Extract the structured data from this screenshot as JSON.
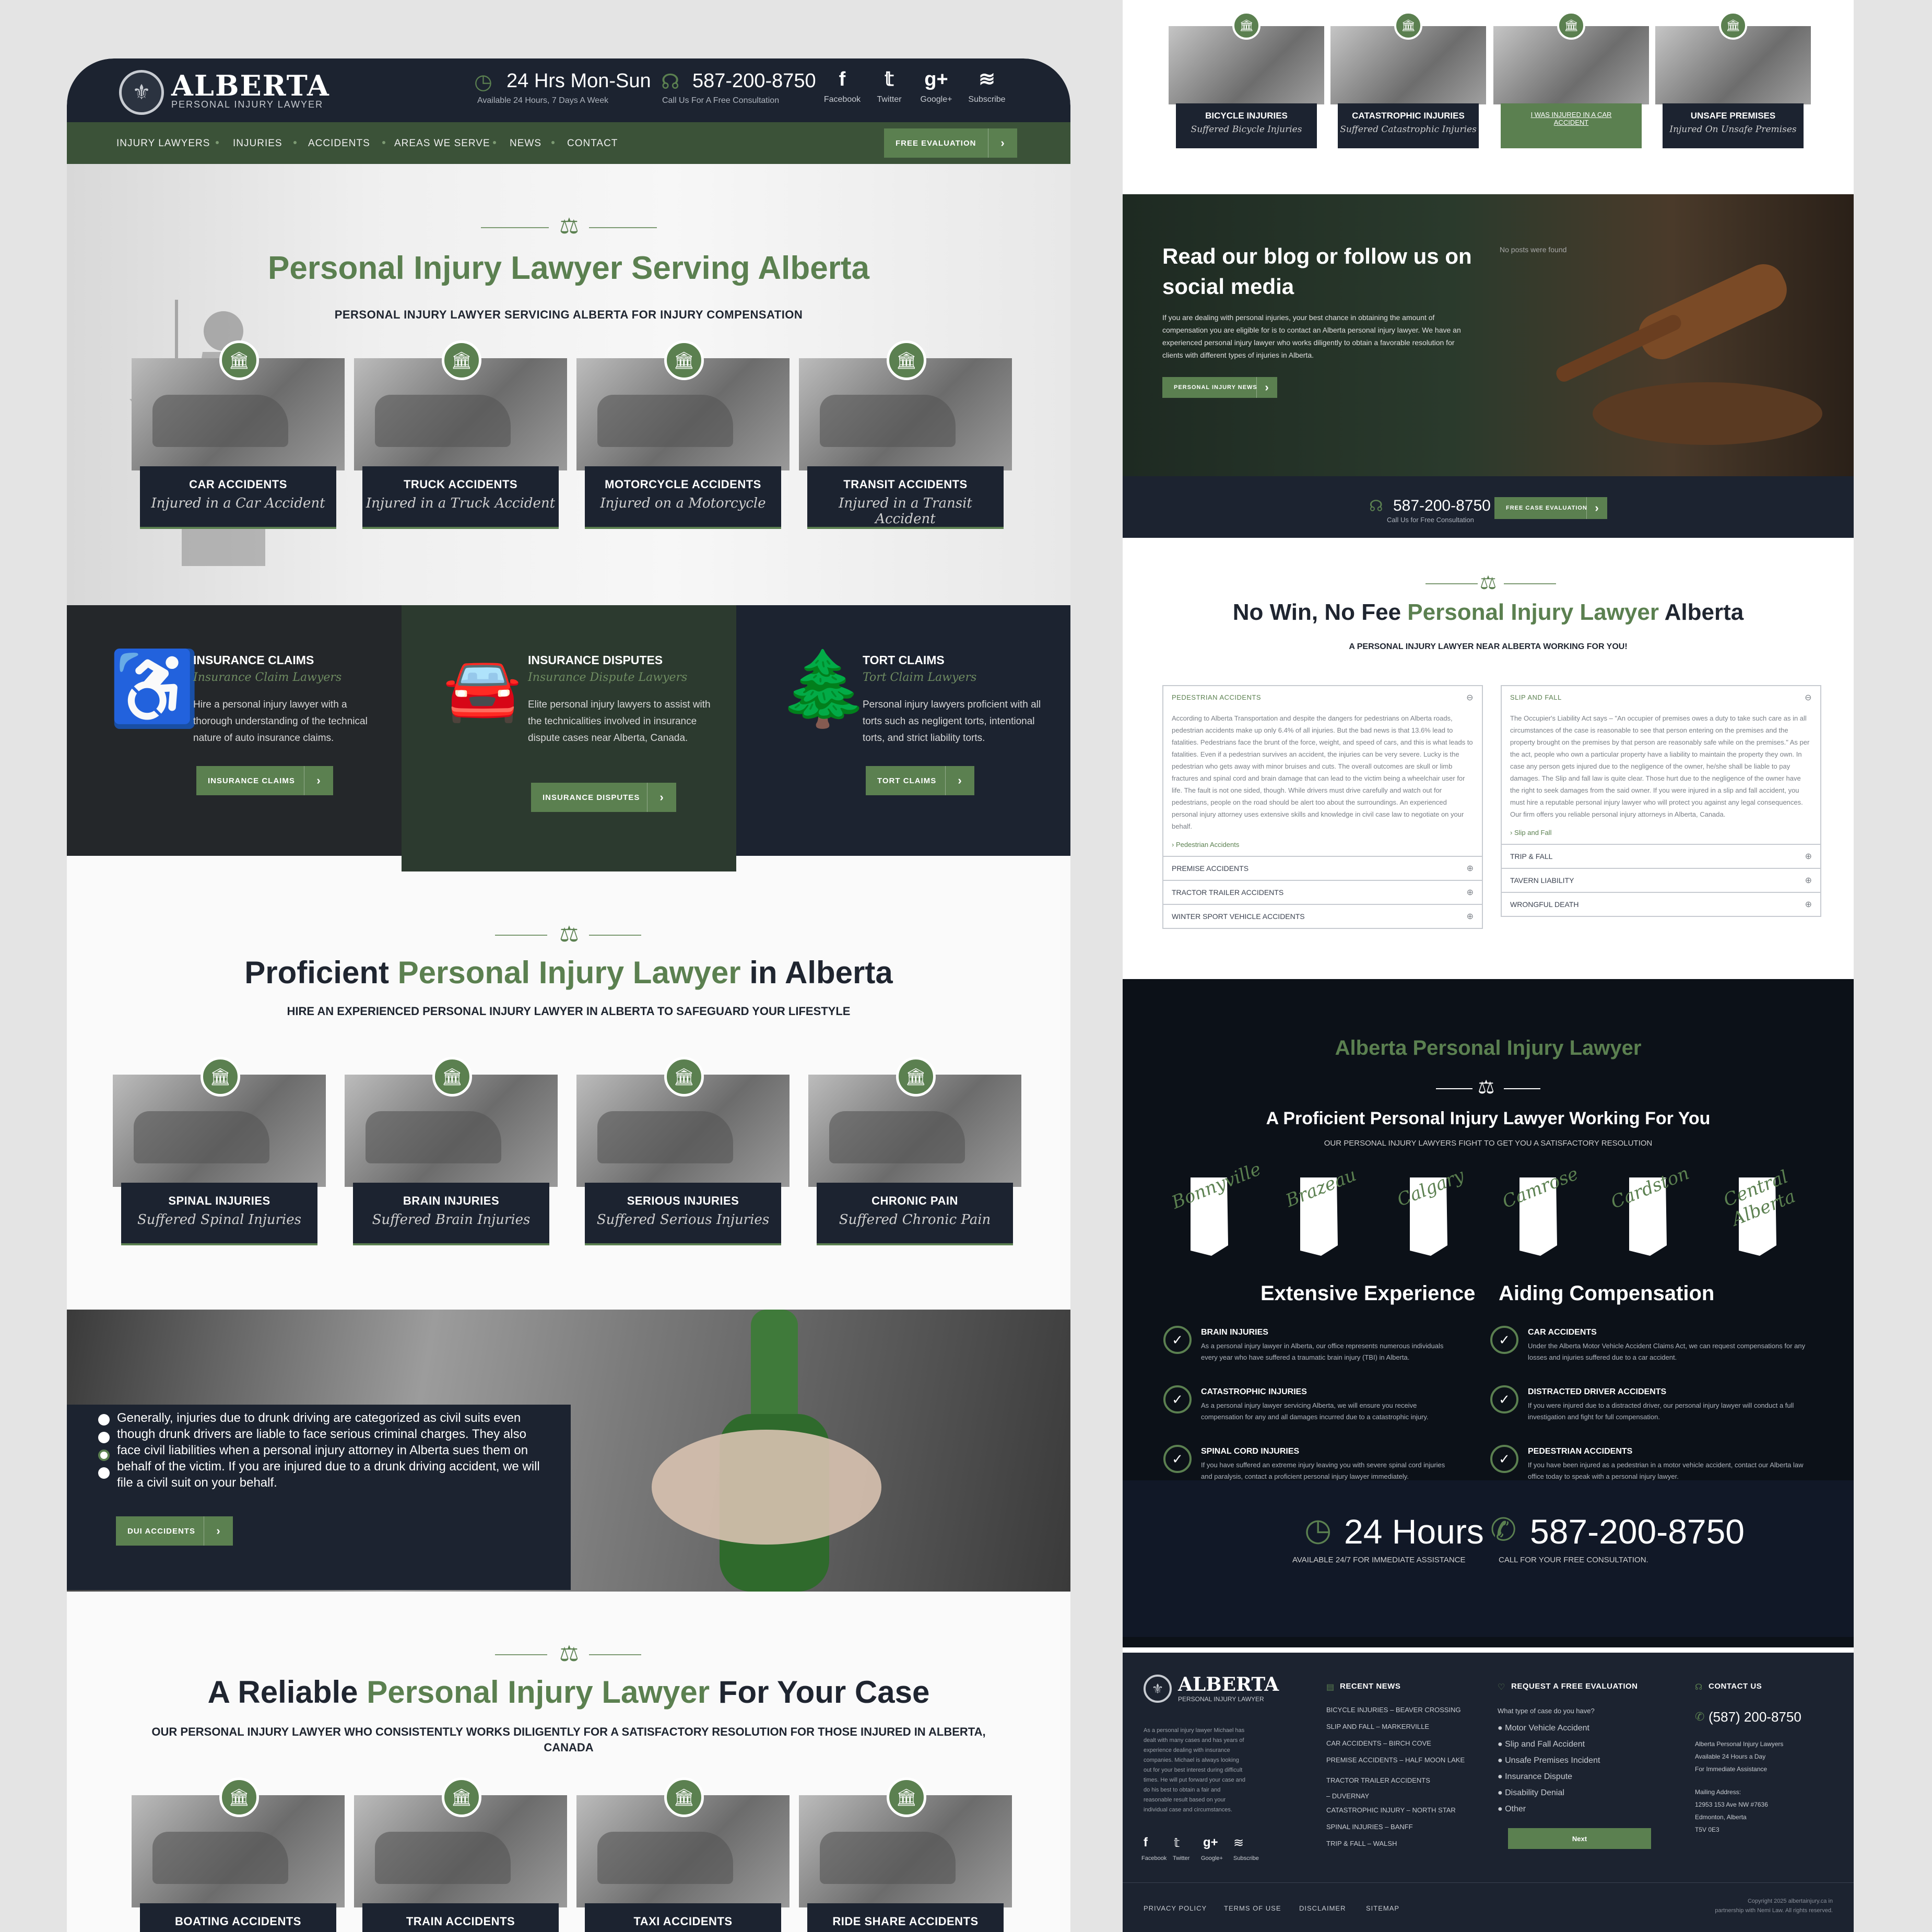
{
  "header": {
    "logo_title": "ALBERTA",
    "logo_subtitle": "PERSONAL INJURY LAWYER",
    "hours_main": "24 Hrs Mon-Sun",
    "hours_sub": "Available 24 Hours, 7 Days A Week",
    "phone_main": "587-200-8750",
    "phone_sub": "Call Us For A Free Consultation",
    "social": [
      {
        "glyph": "f",
        "label": "Facebook"
      },
      {
        "glyph": "𝕥",
        "label": "Twitter"
      },
      {
        "glyph": "g+",
        "label": "Google+"
      },
      {
        "glyph": "≋",
        "label": "Subscribe"
      }
    ]
  },
  "nav": {
    "items": [
      "INJURY LAWYERS",
      "INJURIES",
      "ACCIDENTS",
      "AREAS WE SERVE",
      "NEWS",
      "CONTACT"
    ],
    "cta": "FREE EVALUATION"
  },
  "hero": {
    "title": "Personal Injury Lawyer Serving Alberta",
    "subtitle": "PERSONAL INJURY LAWYER SERVICING ALBERTA FOR INJURY COMPENSATION",
    "cards": [
      {
        "t": "CAR ACCIDENTS",
        "s": "Injured in a Car Accident"
      },
      {
        "t": "TRUCK ACCIDENTS",
        "s": "Injured in a Truck Accident"
      },
      {
        "t": "MOTORCYCLE ACCIDENTS",
        "s": "Injured on a Motorcycle"
      },
      {
        "t": "TRANSIT ACCIDENTS",
        "s": "Injured in a Transit Accident"
      }
    ]
  },
  "claims": [
    {
      "t": "INSURANCE CLAIMS",
      "s": "Insurance Claim Lawyers",
      "p": "Hire a personal injury lawyer with a thorough understanding of the technical nature of auto insurance claims.",
      "btn": "INSURANCE CLAIMS"
    },
    {
      "t": "INSURANCE DISPUTES",
      "s": "Insurance Dispute Lawyers",
      "p": "Elite personal injury lawyers to assist with the technicalities involved in insurance dispute cases near Alberta, Canada.",
      "btn": "INSURANCE DISPUTES"
    },
    {
      "t": "TORT CLAIMS",
      "s": "Tort Claim Lawyers",
      "p": "Personal injury lawyers proficient with all torts such as negligent torts, intentional torts, and strict liability torts.",
      "btn": "TORT CLAIMS"
    }
  ],
  "proficient": {
    "h_a": "Proficient ",
    "h_b": "Personal Injury Lawyer",
    "h_c": " in Alberta",
    "sub": "HIRE AN EXPERIENCED PERSONAL INJURY LAWYER IN ALBERTA TO SAFEGUARD YOUR LIFESTYLE",
    "cards": [
      {
        "t": "SPINAL INJURIES",
        "s": "Suffered Spinal Injuries"
      },
      {
        "t": "BRAIN INJURIES",
        "s": "Suffered Brain Injuries"
      },
      {
        "t": "SERIOUS INJURIES",
        "s": "Suffered Serious Injuries"
      },
      {
        "t": "CHRONIC PAIN",
        "s": "Suffered Chronic Pain"
      }
    ]
  },
  "dui": {
    "text": "Generally, injuries due to drunk driving are categorized as civil suits even though drunk drivers are liable to face serious criminal charges. They also face civil liabilities when a personal injury attorney in Alberta sues them on behalf of the victim. If you are injured due to a drunk driving accident, we will file a civil suit on your behalf.",
    "btn": "DUI ACCIDENTS"
  },
  "reliable": {
    "h_a": "A Reliable ",
    "h_b": "Personal Injury Lawyer",
    "h_c": " For Your Case",
    "sub": "OUR PERSONAL INJURY LAWYER WHO CONSISTENTLY WORKS DILIGENTLY FOR A SATISFACTORY RESOLUTION FOR THOSE INJURED IN ALBERTA, CANADA",
    "cards": [
      "BOATING ACCIDENTS",
      "TRAIN ACCIDENTS",
      "TAXI ACCIDENTS",
      "RIDE SHARE ACCIDENTS"
    ]
  },
  "r_cards": [
    {
      "t": "BICYCLE INJURIES",
      "s": "Suffered Bicycle Injuries"
    },
    {
      "t": "CATASTROPHIC INJURIES",
      "s": "Suffered Catastrophic Injuries"
    },
    {
      "t": "I WAS INJURED IN A CAR ACCIDENT",
      "s": ""
    },
    {
      "t": "UNSAFE PREMISES",
      "s": "Injured On Unsafe Premises"
    }
  ],
  "blog": {
    "title": "Read our blog or follow us on social media",
    "no_posts": "No posts were found",
    "text": "If you are dealing with personal injuries, your best chance in obtaining the amount of compensation you are eligible for is to contact an Alberta personal injury lawyer. We have an experienced personal injury lawyer who works diligently to obtain a favorable resolution for clients with different types of injuries in Alberta.",
    "btn": "PERSONAL INJURY NEWS",
    "phone": "587-200-8750",
    "phone_sub": "Call Us for Free Consultation",
    "cta": "FREE CASE EVALUATION"
  },
  "nowin": {
    "h_a": "No Win, No Fee ",
    "h_b": "Personal Injury Lawyer",
    "h_c": " Alberta",
    "sub": "A PERSONAL INJURY LAWYER NEAR ALBERTA WORKING FOR YOU!",
    "left": {
      "head": "PEDESTRIAN ACCIDENTS",
      "body": "According to Alberta Transportation and despite the dangers for pedestrians on Alberta roads, pedestrian accidents make up only 6.4% of all injuries. But the bad news is that 13.6% lead to fatalities. Pedestrians face the brunt of the force, weight, and speed of cars, and this is what leads to fatalities. Even if a pedestrian survives an accident, the injuries can be very severe. Lucky is the pedestrian who gets away with minor bruises and cuts. The overall outcomes are skull or limb fractures and spinal cord and brain damage that can lead to the victim being a wheelchair user for life. The fault is not one sided, though. While drivers must drive carefully and watch out for pedestrians, people on the road should be alert too about the surroundings. An experienced personal injury attorney uses extensive skills and knowledge in civil case law to negotiate on your behalf.",
      "link": "Pedestrian Accidents",
      "rows": [
        "PREMISE ACCIDENTS",
        "TRACTOR TRAILER ACCIDENTS",
        "WINTER SPORT VEHICLE ACCIDENTS"
      ]
    },
    "right": {
      "head": "SLIP AND FALL",
      "body": "The Occupier's Liability Act says – \"An occupier of premises owes a duty to take such care as in all circumstances of the case is reasonable to see that person entering on the premises and the property brought on the premises by that person are reasonably safe while on the premises.\" As per the act, people who own a particular property have a liability to maintain the property they own. In case any person gets injured due to the negligence of the owner, he/she shall be liable to pay damages. The Slip and fall law is quite clear. Those hurt due to the negligence of the owner have the right to seek damages from the said owner. If you were injured in a slip and fall accident, you must hire a reputable personal injury lawyer who will protect you against any legal consequences. Our firm offers you reliable personal injury attorneys in Alberta, Canada.",
      "link": "Slip and Fall",
      "rows": [
        "TRIP & FALL",
        "TAVERN LIABILITY",
        "WRONGFUL DEATH"
      ]
    }
  },
  "working": {
    "green_title": "Alberta Personal Injury Lawyer",
    "title": "A Proficient Personal Injury Lawyer Working For You",
    "sub": "OUR PERSONAL INJURY LAWYERS FIGHT TO GET YOU A SATISFACTORY RESOLUTION",
    "cities": [
      "Bonnyville",
      "Brazeau",
      "Calgary",
      "Camrose",
      "Cardston",
      "Central Alberta"
    ],
    "h2a": "Extensive Experience",
    "h2b": "Aiding Compensation",
    "items": [
      {
        "t": "BRAIN INJURIES",
        "p": "As a personal injury lawyer in Alberta, our office represents numerous individuals every year who have suffered a traumatic brain injury (TBI) in Alberta."
      },
      {
        "t": "CAR ACCIDENTS",
        "p": "Under the Alberta Motor Vehicle Accident Claims Act, we can request compensations for any losses and injuries suffered due to a car accident."
      },
      {
        "t": "CATASTROPHIC INJURIES",
        "p": "As a personal injury lawyer servicing Alberta, we will ensure you receive compensation for any and all damages incurred due to a catastrophic injury."
      },
      {
        "t": "DISTRACTED DRIVER ACCIDENTS",
        "p": "If you were injured due to a distracted driver, our personal injury lawyer will conduct a full investigation and fight for full compensation."
      },
      {
        "t": "SPINAL CORD INJURIES",
        "p": "If you have suffered an extreme injury leaving you with severe spinal cord injuries and paralysis, contact a proficient personal injury lawyer immediately."
      },
      {
        "t": "PEDESTRIAN ACCIDENTS",
        "p": "If you have been injured as a pedestrian in a motor vehicle accident, contact our Alberta law office today to speak with a personal injury lawyer."
      }
    ],
    "hours": "24 Hours",
    "hours_sub": "AVAILABLE 24/7 FOR IMMEDIATE ASSISTANCE",
    "phone": "587-200-8750",
    "phone_sub": "CALL FOR YOUR FREE CONSULTATION."
  },
  "footer": {
    "about": "As a personal injury lawyer Michael has dealt with many cases and has years of experience dealing with insurance companies. Michael is always looking out for your best interest during difficult times. He will put forward your case and do his best to obtain a fair and reasonable result based on your individual case and circumstances.",
    "news_h": "RECENT NEWS",
    "news": [
      "BICYCLE INJURIES – BEAVER CROSSING",
      "SLIP AND FALL – MARKERVILLE",
      "CAR ACCIDENTS – BIRCH COVE",
      "PREMISE ACCIDENTS – HALF MOON LAKE",
      "TRACTOR TRAILER ACCIDENTS – DUVERNAY",
      "CATASTROPHIC INJURY – NORTH STAR",
      "SPINAL INJURIES – BANFF",
      "TRIP & FALL – WALSH"
    ],
    "eval_h": "REQUEST A FREE EVALUATION",
    "eval_q": "What type of case do you have?",
    "eval_opts": [
      "Motor Vehicle Accident",
      "Slip and Fall Accident",
      "Unsafe Premises Incident",
      "Insurance Dispute",
      "Disability Denial",
      "Other"
    ],
    "next": "Next",
    "contact_h": "CONTACT US",
    "phone": "(587) 200-8750",
    "c1": "Alberta Personal Injury Lawyers",
    "c2": "Available 24 Hours a Day",
    "c3": "For Immediate Assistance",
    "addr_h": "Mailing Address:",
    "addr1": "12953 153 Ave NW #7636",
    "addr2": "Edmonton, Alberta",
    "addr3": "T5V 0E3",
    "links": [
      "PRIVACY POLICY",
      "TERMS OF USE",
      "DISCLAIMER",
      "SITEMAP"
    ],
    "copy1": "Copyright 2025 albertainjury.ca in",
    "copy2": "partnership with Nemi Law. All rights reserved."
  },
  "colors": {
    "navy": "#1c2330",
    "green": "#5b8050",
    "navbar": "#3b5238"
  }
}
